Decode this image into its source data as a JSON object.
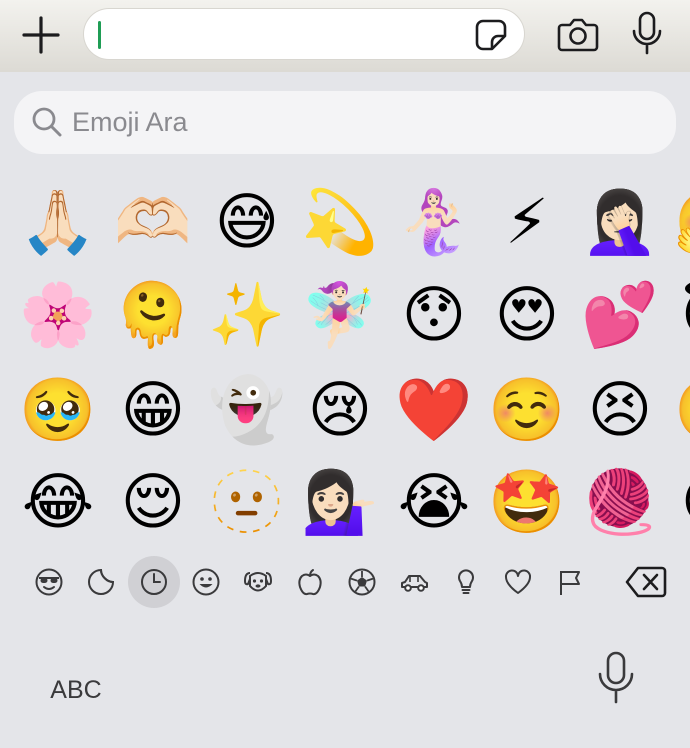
{
  "top_bar": {
    "icons": [
      "plus-icon",
      "sticker-icon",
      "camera-icon",
      "mic-icon"
    ],
    "message_value": ""
  },
  "search": {
    "placeholder": "Emoji Ara"
  },
  "emoji_rows": [
    [
      "🙏🏻",
      "🫶🏻",
      "😅",
      "💫",
      "🧜🏻‍♀️",
      "⚡",
      "🤦🏻‍♀️",
      "🤗"
    ],
    [
      "🌸",
      "🫠",
      "✨",
      "🧚🏻‍♀️",
      "😯",
      "😍",
      "💕",
      "😇"
    ],
    [
      "🥹",
      "😁",
      "👻",
      "😢",
      "❤️",
      "☺️",
      "😣",
      "🥲"
    ],
    [
      "😂",
      "😌",
      "🫥",
      "💁🏻‍♀️",
      "😭",
      "🤩",
      "🧶",
      "😔"
    ]
  ],
  "categories": [
    {
      "name": "frequently-used-smiley",
      "icon": "sunglasses-face-icon"
    },
    {
      "name": "sticker",
      "icon": "sticker-icon"
    },
    {
      "name": "recent",
      "icon": "clock-icon",
      "active": true
    },
    {
      "name": "smileys",
      "icon": "smiley-icon"
    },
    {
      "name": "animals",
      "icon": "dog-icon"
    },
    {
      "name": "food",
      "icon": "apple-icon"
    },
    {
      "name": "activity",
      "icon": "soccer-ball-icon"
    },
    {
      "name": "travel",
      "icon": "car-icon"
    },
    {
      "name": "objects",
      "icon": "lightbulb-icon"
    },
    {
      "name": "symbols",
      "icon": "heart-icon"
    },
    {
      "name": "flags",
      "icon": "flag-icon"
    }
  ],
  "keyboard": {
    "abc_label": "ABC"
  },
  "colors": {
    "caret": "#1f9d55",
    "background": "#e4e5e9",
    "icon": "#3a3a3c"
  }
}
